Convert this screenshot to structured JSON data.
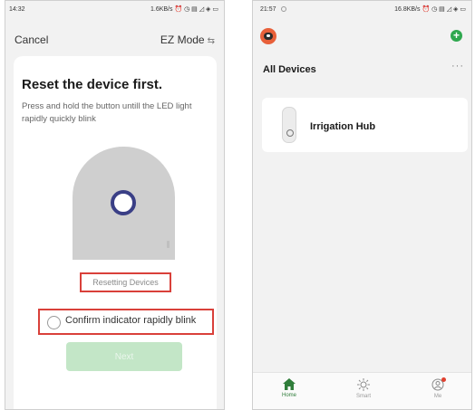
{
  "left_screen": {
    "status_time": "14:32",
    "status_icons": "1.6KB/s ⏰ ◷ ▤ ◿ ◈ ▭",
    "nav": {
      "cancel_label": "Cancel",
      "mode_label": "EZ Mode",
      "mode_icon": "swap-icon"
    },
    "heading": "Reset the device first.",
    "instruction": "Press and hold the button untill the LED light rapidly quickly blink",
    "reset_link_label": "Resetting Devices",
    "confirm_label": "Confirm indicator rapidly blink",
    "confirm_checked": false,
    "next_label": "Next",
    "colors": {
      "highlight": "#d9403a",
      "button_disabled": "#c3e6c7",
      "device_ring": "#3a3f86"
    }
  },
  "right_screen": {
    "status_time": "21:57",
    "status_icons": "16.8KB/s ⏰ ◷ ▤ ◿ ◈ ▭",
    "add_icon": "plus-circle-icon",
    "section_title": "All Devices",
    "more_label": "···",
    "devices": [
      {
        "name": "Irrigation Hub",
        "icon": "hub-plug-icon"
      }
    ],
    "tabs": [
      {
        "label": "Home",
        "icon": "home-icon",
        "active": true
      },
      {
        "label": "Smart",
        "icon": "sun-icon",
        "active": false
      },
      {
        "label": "Me",
        "icon": "user-icon",
        "active": false
      }
    ],
    "colors": {
      "accent": "#2fa84f",
      "avatar": "#e8603a",
      "badge": "#e0402f"
    }
  }
}
